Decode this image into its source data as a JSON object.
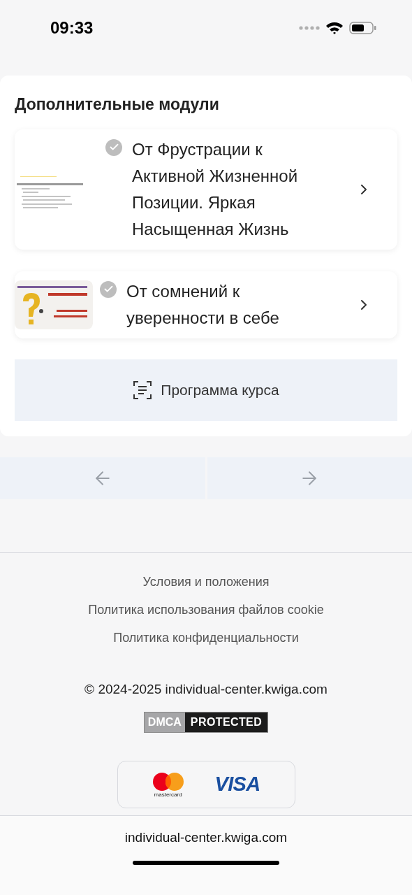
{
  "status_bar": {
    "time": "09:33"
  },
  "section": {
    "title": "Дополнительные модули",
    "modules": [
      {
        "title": "От Фрустрации к Активной Жизненной Позиции. Яркая Насыщенная Жизнь",
        "completed": true
      },
      {
        "title": "От сомнений к уверенности в себе",
        "completed": true
      }
    ],
    "program_button": "Программа курса"
  },
  "footer": {
    "links": [
      "Условия и положения",
      "Политика использования файлов cookie",
      "Политика конфиденциальности"
    ],
    "copyright": "© 2024-2025 individual-center.kwiga.com",
    "dmca": [
      "DMCA",
      "PROTECTED"
    ],
    "payments": [
      "mastercard",
      "VISA"
    ]
  },
  "browser_bar": {
    "url": "individual-center.kwiga.com"
  }
}
